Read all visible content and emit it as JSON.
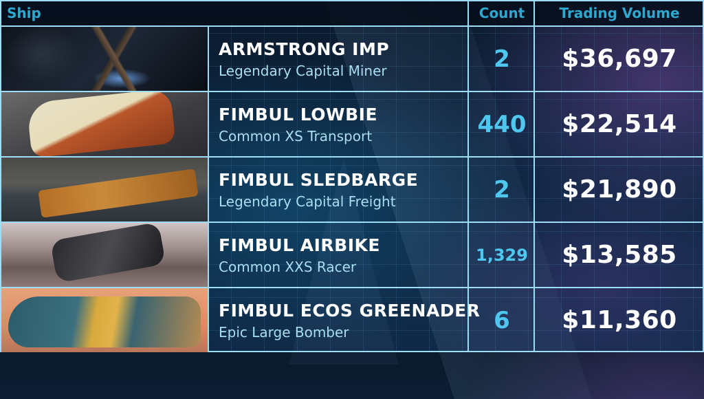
{
  "table": {
    "headers": {
      "ship": "Ship",
      "count": "Count",
      "volume": "Trading Volume"
    },
    "rows": [
      {
        "name": "ARMSTRONG IMP",
        "class": "Legendary Capital Miner",
        "count": "2",
        "volume": "$36,697",
        "thumbnail": "armstrong-imp-image"
      },
      {
        "name": "FIMBUL LOWBIE",
        "class": "Common XS Transport",
        "count": "440",
        "volume": "$22,514",
        "thumbnail": "fimbul-lowbie-image"
      },
      {
        "name": "FIMBUL SLEDBARGE",
        "class": "Legendary Capital Freight",
        "count": "2",
        "volume": "$21,890",
        "thumbnail": "fimbul-sledbarge-image"
      },
      {
        "name": "FIMBUL AIRBIKE",
        "class": "Common XXS Racer",
        "count": "1,329",
        "volume": "$13,585",
        "thumbnail": "fimbul-airbike-image"
      },
      {
        "name": "FIMBUL ECOS GREENADER",
        "class": "Epic Large Bomber",
        "count": "6",
        "volume": "$11,360",
        "thumbnail": "fimbul-ecos-greenader-image"
      }
    ]
  },
  "colors": {
    "border": "#9fdcf5",
    "header_text": "#2fa8d0",
    "count_text": "#4fc6ee",
    "class_text": "#a9def2",
    "name_text": "#ffffff"
  }
}
